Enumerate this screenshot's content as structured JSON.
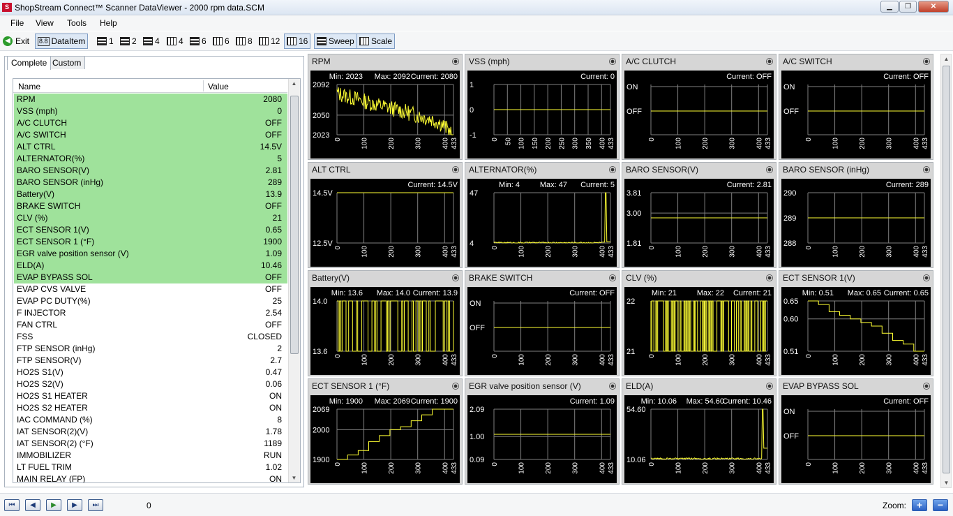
{
  "window": {
    "title": "ShopStream Connect™ Scanner DataViewer - 2000 rpm data.SCM",
    "app_icon": "snap-on-logo-icon"
  },
  "menu": [
    "File",
    "View",
    "Tools",
    "Help"
  ],
  "toolbar": {
    "exit": "Exit",
    "dataitem": "DataItem",
    "layouts": [
      "1",
      "2",
      "4",
      "4",
      "6",
      "6",
      "8",
      "12",
      "16"
    ],
    "sweep": "Sweep",
    "scale": "Scale"
  },
  "tabs": {
    "complete": "Complete",
    "custom": "Custom"
  },
  "list": {
    "header_name": "Name",
    "header_value": "Value",
    "rows": [
      {
        "name": "RPM",
        "value": "2080",
        "hl": true
      },
      {
        "name": "VSS (mph)",
        "value": "0",
        "hl": true
      },
      {
        "name": "A/C CLUTCH",
        "value": "OFF",
        "hl": true
      },
      {
        "name": "A/C SWITCH",
        "value": "OFF",
        "hl": true
      },
      {
        "name": "ALT CTRL",
        "value": "14.5V",
        "hl": true
      },
      {
        "name": "ALTERNATOR(%)",
        "value": "5",
        "hl": true
      },
      {
        "name": "BARO SENSOR(V)",
        "value": "2.81",
        "hl": true
      },
      {
        "name": "BARO SENSOR (inHg)",
        "value": "289",
        "hl": true
      },
      {
        "name": "Battery(V)",
        "value": "13.9",
        "hl": true
      },
      {
        "name": "BRAKE SWITCH",
        "value": "OFF",
        "hl": true
      },
      {
        "name": "CLV (%)",
        "value": "21",
        "hl": true
      },
      {
        "name": "ECT SENSOR 1(V)",
        "value": "0.65",
        "hl": true
      },
      {
        "name": "ECT SENSOR 1 (°F)",
        "value": "1900",
        "hl": true
      },
      {
        "name": "EGR valve position sensor (V)",
        "value": "1.09",
        "hl": true
      },
      {
        "name": "ELD(A)",
        "value": "10.46",
        "hl": true
      },
      {
        "name": "EVAP BYPASS SOL",
        "value": "OFF",
        "hl": true
      },
      {
        "name": "EVAP CVS VALVE",
        "value": "OFF",
        "hl": false
      },
      {
        "name": "EVAP PC DUTY(%)",
        "value": "25",
        "hl": false
      },
      {
        "name": "F INJECTOR",
        "value": "2.54",
        "hl": false
      },
      {
        "name": "FAN CTRL",
        "value": "OFF",
        "hl": false
      },
      {
        "name": "FSS",
        "value": "CLOSED",
        "hl": false
      },
      {
        "name": "FTP SENSOR (inHg)",
        "value": "2",
        "hl": false
      },
      {
        "name": "FTP SENSOR(V)",
        "value": "2.7",
        "hl": false
      },
      {
        "name": "HO2S S1(V)",
        "value": "0.47",
        "hl": false
      },
      {
        "name": "HO2S S2(V)",
        "value": "0.06",
        "hl": false
      },
      {
        "name": "HO2S S1 HEATER",
        "value": "ON",
        "hl": false
      },
      {
        "name": "HO2S S2 HEATER",
        "value": "ON",
        "hl": false
      },
      {
        "name": "IAC COMMAND (%)",
        "value": "8",
        "hl": false
      },
      {
        "name": "IAT SENSOR(2)(V)",
        "value": "1.78",
        "hl": false
      },
      {
        "name": "IAT SENSOR(2) (°F)",
        "value": "1189",
        "hl": false
      },
      {
        "name": "IMMOBILIZER",
        "value": "RUN",
        "hl": false
      },
      {
        "name": "LT FUEL TRIM",
        "value": "1.02",
        "hl": false
      },
      {
        "name": "MAIN RELAY (FP)",
        "value": "ON",
        "hl": false
      }
    ]
  },
  "status": {
    "frame": "0",
    "zoom": "Zoom:"
  },
  "colors": {
    "trace": "#ffff33",
    "grid": "#808080",
    "panel_bg": "#000000",
    "highlight": "#9fe29b"
  },
  "chart_data": [
    {
      "title": "RPM",
      "type": "line",
      "stats": [
        "Min: 2023",
        "Max: 2092",
        "Current: 2080"
      ],
      "yticks": [
        "2092",
        "2050",
        "2023"
      ],
      "ylim": [
        2023,
        2092
      ],
      "xticks": [
        "0",
        "100",
        "200",
        "300",
        "400",
        "433"
      ],
      "xlim": [
        0,
        433
      ],
      "shape": "noisy_decline",
      "values": [
        2080,
        2075,
        2071,
        2066,
        2062,
        2058,
        2054,
        2049,
        2045,
        2038,
        2023
      ]
    },
    {
      "title": "VSS (mph)",
      "type": "line",
      "stats": [
        "Current: 0"
      ],
      "yticks": [
        "1",
        "0",
        "-1"
      ],
      "ylim": [
        -1,
        1
      ],
      "xticks": [
        "0",
        "50",
        "100",
        "150",
        "200",
        "250",
        "300",
        "350",
        "400",
        "433"
      ],
      "xlim": [
        0,
        433
      ],
      "shape": "flat",
      "values": [
        0,
        0
      ]
    },
    {
      "title": "A/C CLUTCH",
      "type": "line",
      "stats": [
        "Current: OFF"
      ],
      "yticks": [
        "ON",
        "OFF"
      ],
      "ylim": [
        0,
        1
      ],
      "xticks": [
        "0",
        "100",
        "200",
        "300",
        "400",
        "433"
      ],
      "xlim": [
        0,
        433
      ],
      "shape": "flat",
      "values": [
        0,
        0
      ]
    },
    {
      "title": "A/C SWITCH",
      "type": "line",
      "stats": [
        "Current: OFF"
      ],
      "yticks": [
        "ON",
        "OFF"
      ],
      "ylim": [
        0,
        1
      ],
      "xticks": [
        "0",
        "100",
        "200",
        "300",
        "400",
        "433"
      ],
      "xlim": [
        0,
        433
      ],
      "shape": "flat",
      "values": [
        0,
        0
      ]
    },
    {
      "title": "ALT CTRL",
      "type": "line",
      "stats": [
        "Current: 14.5V"
      ],
      "yticks": [
        "14.5V",
        "12.5V"
      ],
      "ylim": [
        12.5,
        14.5
      ],
      "xticks": [
        "0",
        "100",
        "200",
        "300",
        "400",
        "433"
      ],
      "xlim": [
        0,
        433
      ],
      "shape": "flat",
      "values": [
        14.5,
        14.5
      ]
    },
    {
      "title": "ALTERNATOR(%)",
      "type": "line",
      "stats": [
        "Min: 4",
        "Max: 47",
        "Current: 5"
      ],
      "yticks": [
        "47",
        "4"
      ],
      "ylim": [
        4,
        47
      ],
      "xticks": [
        "0",
        "100",
        "200",
        "300",
        "400",
        "433"
      ],
      "xlim": [
        0,
        433
      ],
      "shape": "low_spike_end",
      "values": [
        4,
        5,
        4,
        5,
        5,
        4,
        5,
        6,
        47,
        5
      ]
    },
    {
      "title": "BARO SENSOR(V)",
      "type": "line",
      "stats": [
        "Current: 2.81"
      ],
      "yticks": [
        "3.81",
        "3.00",
        "1.81"
      ],
      "ylim": [
        1.81,
        3.81
      ],
      "xticks": [
        "0",
        "100",
        "200",
        "300",
        "400",
        "433"
      ],
      "xlim": [
        0,
        433
      ],
      "shape": "flat",
      "values": [
        2.81,
        2.81
      ]
    },
    {
      "title": "BARO SENSOR (inHg)",
      "type": "line",
      "stats": [
        "Current: 289"
      ],
      "yticks": [
        "290",
        "289",
        "288"
      ],
      "ylim": [
        288,
        290
      ],
      "xticks": [
        "0",
        "100",
        "200",
        "300",
        "400",
        "433"
      ],
      "xlim": [
        0,
        433
      ],
      "shape": "flat",
      "values": [
        289,
        289
      ]
    },
    {
      "title": "Battery(V)",
      "type": "line",
      "stats": [
        "Min: 13.6",
        "Max: 14.0",
        "Current: 13.9"
      ],
      "yticks": [
        "14.0",
        "13.6"
      ],
      "ylim": [
        13.6,
        14.0
      ],
      "xticks": [
        "0",
        "100",
        "200",
        "300",
        "400",
        "433"
      ],
      "xlim": [
        0,
        433
      ],
      "shape": "dense_toggle",
      "values": [
        14.0,
        13.6,
        14.0,
        13.9
      ]
    },
    {
      "title": "BRAKE SWITCH",
      "type": "line",
      "stats": [
        "Current: OFF"
      ],
      "yticks": [
        "ON",
        "OFF"
      ],
      "ylim": [
        0,
        1
      ],
      "xticks": [
        "0",
        "100",
        "200",
        "300",
        "400",
        "433"
      ],
      "xlim": [
        0,
        433
      ],
      "shape": "flat",
      "values": [
        0,
        0
      ]
    },
    {
      "title": "CLV (%)",
      "type": "line",
      "stats": [
        "Min: 21",
        "Max: 22",
        "Current: 21"
      ],
      "yticks": [
        "22",
        "21"
      ],
      "ylim": [
        21,
        22
      ],
      "xticks": [
        "0",
        "100",
        "200",
        "300",
        "400",
        "433"
      ],
      "xlim": [
        0,
        433
      ],
      "shape": "binary_toggle",
      "values": [
        21,
        22,
        21
      ]
    },
    {
      "title": "ECT SENSOR 1(V)",
      "type": "line",
      "stats": [
        "Min: 0.51",
        "Max: 0.65",
        "Current: 0.65"
      ],
      "yticks": [
        "0.65",
        "0.60",
        "0.51"
      ],
      "ylim": [
        0.51,
        0.65
      ],
      "xticks": [
        "0",
        "100",
        "200",
        "300",
        "400",
        "433"
      ],
      "xlim": [
        0,
        433
      ],
      "shape": "step",
      "values": [
        0.65,
        0.64,
        0.62,
        0.61,
        0.6,
        0.59,
        0.58,
        0.56,
        0.54,
        0.53,
        0.51
      ]
    },
    {
      "title": "ECT SENSOR 1 (°F)",
      "type": "line",
      "stats": [
        "Min: 1900",
        "Max: 2069",
        "Current: 1900"
      ],
      "yticks": [
        "2069",
        "2000",
        "1900"
      ],
      "ylim": [
        1900,
        2069
      ],
      "xticks": [
        "0",
        "100",
        "200",
        "300",
        "400",
        "433"
      ],
      "xlim": [
        0,
        433
      ],
      "shape": "step",
      "values": [
        1900,
        1915,
        1930,
        1960,
        1980,
        2000,
        2010,
        2030,
        2050,
        2069,
        2069
      ]
    },
    {
      "title": "EGR valve position sensor (V)",
      "type": "line",
      "stats": [
        "Current: 1.09"
      ],
      "yticks": [
        "2.09",
        "1.00",
        "0.09"
      ],
      "ylim": [
        0.09,
        2.09
      ],
      "xticks": [
        "0",
        "100",
        "200",
        "300",
        "400",
        "433"
      ],
      "xlim": [
        0,
        433
      ],
      "shape": "flat",
      "values": [
        1.09,
        1.09
      ]
    },
    {
      "title": "ELD(A)",
      "type": "line",
      "stats": [
        "Min: 10.06",
        "Max: 54.60",
        "Current: 10.46"
      ],
      "yticks": [
        "54.60",
        "10.06"
      ],
      "ylim": [
        10.06,
        54.6
      ],
      "xticks": [
        "0",
        "100",
        "200",
        "300",
        "400",
        "433"
      ],
      "xlim": [
        0,
        433
      ],
      "shape": "low_spike_end",
      "values": [
        10.5,
        10.8,
        10.4,
        10.9,
        10.6,
        10.5,
        11.0,
        10.7,
        54.6,
        20
      ]
    },
    {
      "title": "EVAP BYPASS SOL",
      "type": "line",
      "stats": [
        "Current: OFF"
      ],
      "yticks": [
        "ON",
        "OFF"
      ],
      "ylim": [
        0,
        1
      ],
      "xticks": [
        "0",
        "100",
        "200",
        "300",
        "400",
        "433"
      ],
      "xlim": [
        0,
        433
      ],
      "shape": "flat",
      "values": [
        0,
        0
      ]
    }
  ]
}
